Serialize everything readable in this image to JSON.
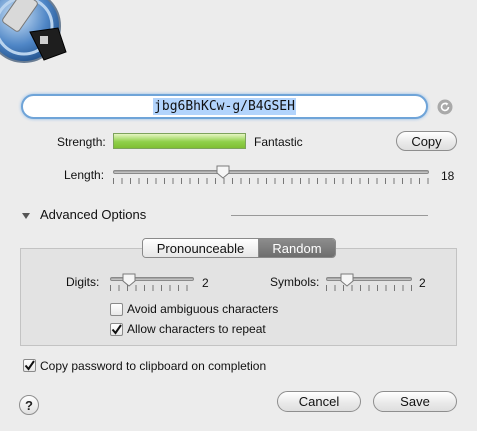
{
  "logo": {
    "icon": "1password-keyhole-icon"
  },
  "password": {
    "value": "jbg6BhKCw-g/B4GSEH"
  },
  "strength": {
    "label": "Strength:",
    "value_text": "Fantastic",
    "level": 1.0,
    "color": "#8fd04a"
  },
  "copy_button": {
    "label": "Copy"
  },
  "length": {
    "label": "Length:",
    "value": "18",
    "fraction": 0.35
  },
  "advanced": {
    "label": "Advanced Options",
    "expanded": true
  },
  "mode_tabs": [
    {
      "label": "Pronounceable",
      "selected": false
    },
    {
      "label": "Random",
      "selected": true
    }
  ],
  "digits": {
    "label": "Digits:",
    "value": "2"
  },
  "symbols": {
    "label": "Symbols:",
    "value": "2"
  },
  "options": {
    "avoid_ambiguous": {
      "label": "Avoid ambiguous characters",
      "checked": false
    },
    "allow_repeat": {
      "label": "Allow characters to repeat",
      "checked": true
    }
  },
  "copy_to_clipboard": {
    "label": "Copy password to clipboard on completion",
    "checked": true
  },
  "help_button": {
    "label": "?"
  },
  "cancel_button": {
    "label": "Cancel"
  },
  "save_button": {
    "label": "Save"
  }
}
